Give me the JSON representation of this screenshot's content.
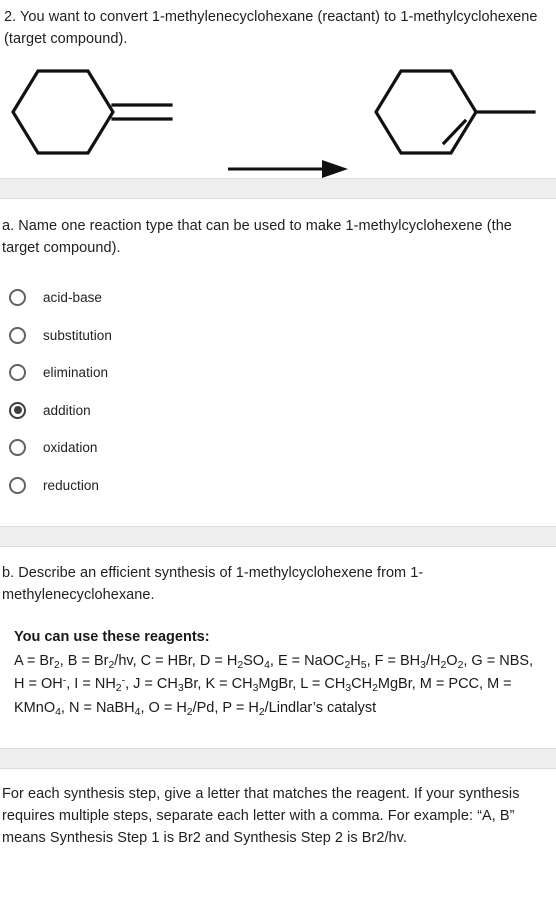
{
  "question": {
    "number": "2.",
    "prompt": "2. You want to convert 1-methylenecyclohexane (reactant) to 1-methylcyclohexene (target compound)."
  },
  "scheme": {
    "reactant_name": "1-methylenecyclohexane",
    "product_name": "1-methylcyclohexene",
    "arrow": "reaction-arrow-right"
  },
  "part_a": {
    "prompt": "a. Name one reaction type that can be used to make 1-methylcyclohexene (the target compound).",
    "selected": "addition",
    "options": [
      {
        "label": "acid-base",
        "checked": false
      },
      {
        "label": "substitution",
        "checked": false
      },
      {
        "label": "elimination",
        "checked": false
      },
      {
        "label": "addition",
        "checked": true
      },
      {
        "label": "oxidation",
        "checked": false
      },
      {
        "label": "reduction",
        "checked": false
      }
    ]
  },
  "part_b": {
    "prompt": "b. Describe an efficient synthesis of 1-methylcyclohexene from 1-methylenecyclohexane.",
    "reagents_title": "You can use these reagents:",
    "reagents_html": "A = Br<sub>2</sub>, B = Br<sub>2</sub>/hv, C = HBr, D = H<sub>2</sub>SO<sub>4</sub>, E = NaOC<sub>2</sub>H<sub>5</sub>, F = BH<sub>3</sub>/H<sub>2</sub>O<sub>2</sub>, G = NBS, H = OH<sup>-</sup>, I = NH<sub>2</sub><sup>-</sup>, J = CH<sub>3</sub>Br, K = CH<sub>3</sub>MgBr, L = CH<sub>3</sub>CH<sub>2</sub>MgBr, M = PCC, M = KMnO<sub>4</sub>, N = NaBH<sub>4</sub>, O = H<sub>2</sub>/Pd, P = H<sub>2</sub>/Lindlar’s catalyst",
    "reagents_plain": "A = Br2, B = Br2/hv, C = HBr, D = H2SO4, E = NaOC2H5, F = BH3/H2O2, G = NBS, H = OH-, I = NH2-, J = CH3Br, K = CH3MgBr, L = CH3CH2MgBr, M = PCC, M = KMnO4, N = NaBH4, O = H2/Pd, P = H2/Lindlar’s catalyst",
    "reagent_list": [
      {
        "letter": "A",
        "value": "Br2"
      },
      {
        "letter": "B",
        "value": "Br2/hv"
      },
      {
        "letter": "C",
        "value": "HBr"
      },
      {
        "letter": "D",
        "value": "H2SO4"
      },
      {
        "letter": "E",
        "value": "NaOC2H5"
      },
      {
        "letter": "F",
        "value": "BH3/H2O2"
      },
      {
        "letter": "G",
        "value": "NBS"
      },
      {
        "letter": "H",
        "value": "OH-"
      },
      {
        "letter": "I",
        "value": "NH2-"
      },
      {
        "letter": "J",
        "value": "CH3Br"
      },
      {
        "letter": "K",
        "value": "CH3MgBr"
      },
      {
        "letter": "L",
        "value": "CH3CH2MgBr"
      },
      {
        "letter": "M",
        "value": "PCC"
      },
      {
        "letter": "M",
        "value": "KMnO4"
      },
      {
        "letter": "N",
        "value": "NaBH4"
      },
      {
        "letter": "O",
        "value": "H2/Pd"
      },
      {
        "letter": "P",
        "value": "H2/Lindlar’s catalyst"
      }
    ]
  },
  "footer": {
    "instruction": "For each synthesis step, give a letter that matches the reagent. If your synthesis requires multiple steps, separate each letter with a comma. For example: “A, B” means Synthesis Step 1 is Br2 and Synthesis Step 2 is Br2/hv."
  },
  "colors": {
    "text": "#202124",
    "divider_bg": "#eeeeee",
    "divider_border": "#dcdcdc",
    "radio": "#5f6368",
    "structure_stroke": "#111111"
  }
}
